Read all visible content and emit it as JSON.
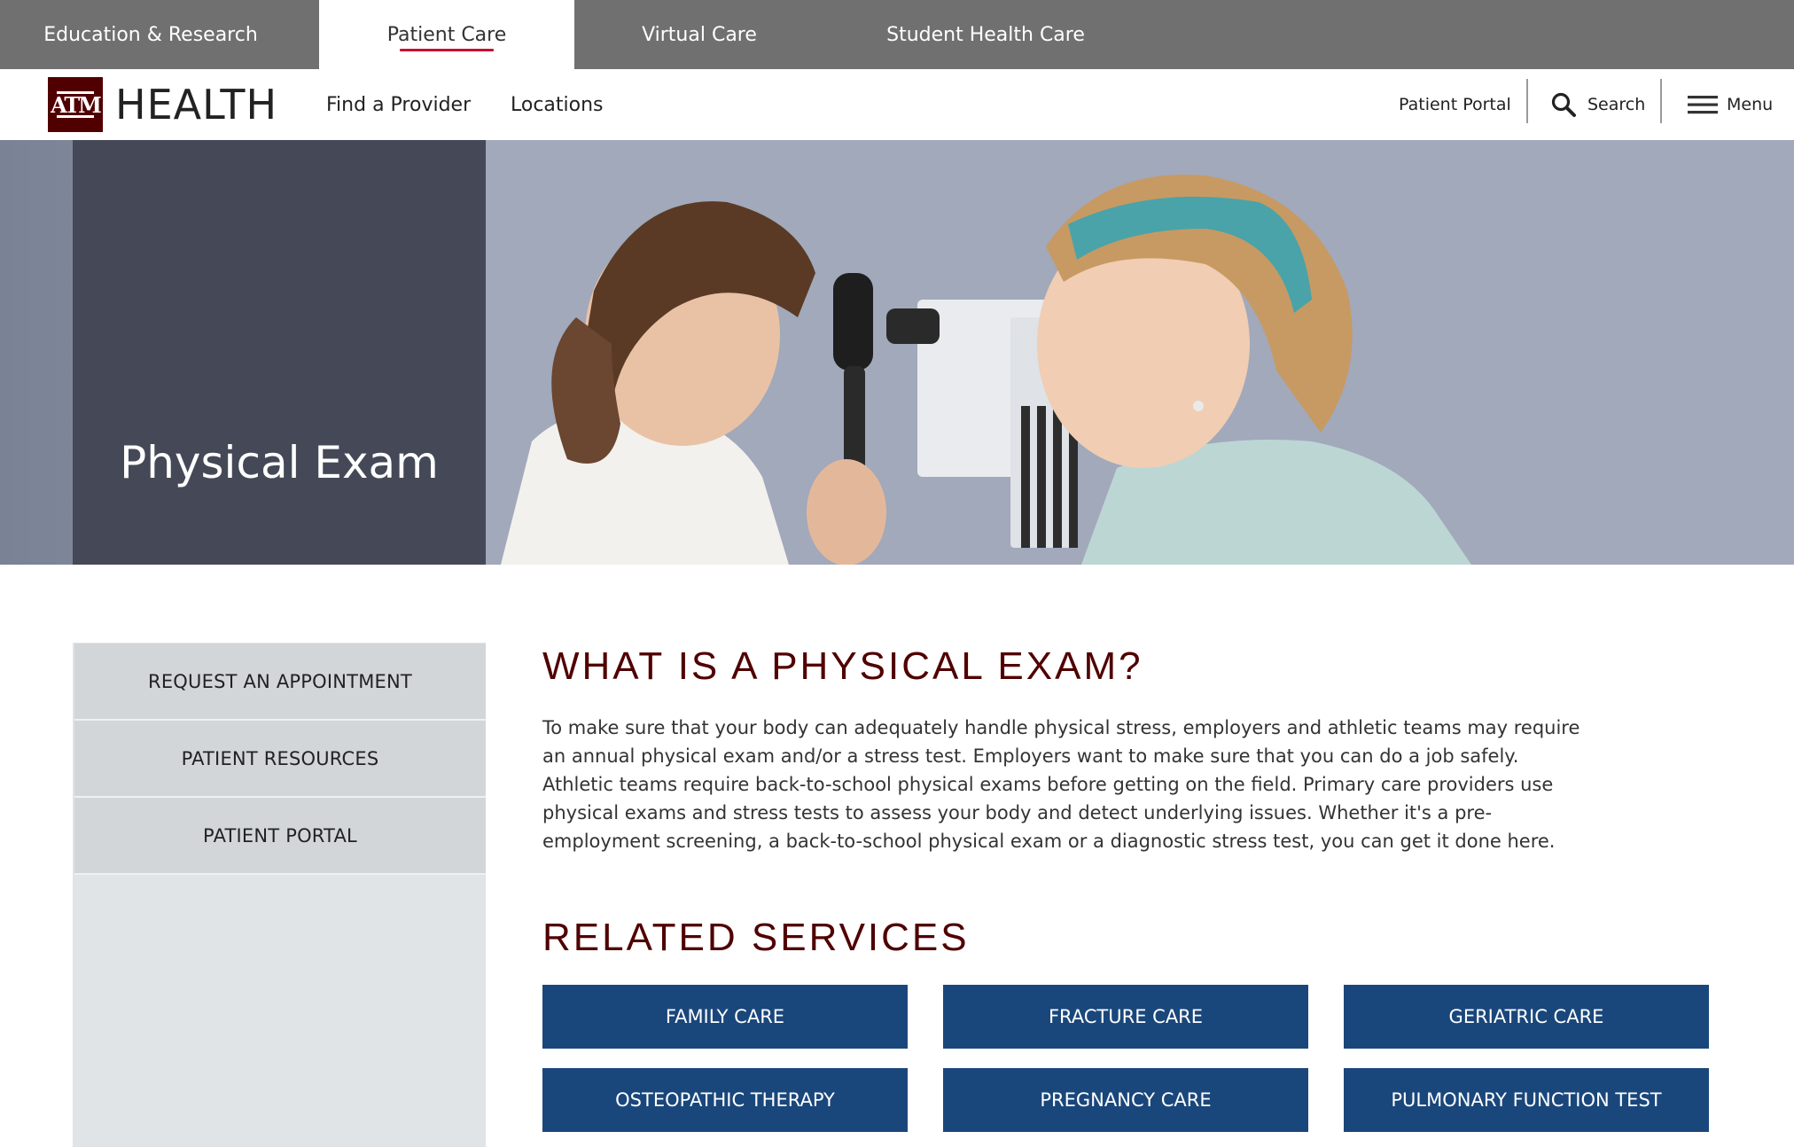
{
  "top_tabs": [
    {
      "label": "Education & Research"
    },
    {
      "label": "Patient Care"
    },
    {
      "label": "Virtual Care"
    },
    {
      "label": "Student Health Care"
    }
  ],
  "header": {
    "logo_mark": "ATM",
    "logo_text": "HEALTH",
    "nav": [
      "Find a Provider",
      "Locations"
    ],
    "patient_portal": "Patient Portal",
    "search": "Search",
    "menu": "Menu"
  },
  "hero": {
    "title": "Physical Exam"
  },
  "sidebar": {
    "items": [
      "REQUEST AN APPOINTMENT",
      "PATIENT RESOURCES",
      "PATIENT PORTAL"
    ]
  },
  "main": {
    "heading": "WHAT IS A PHYSICAL EXAM?",
    "paragraph": "To make sure that your body can adequately handle physical stress, employers and athletic teams may require an annual physical exam and/or a stress test. Employers want to make sure that you can do a job safely. Athletic teams require back-to-school physical exams before getting on the field. Primary care providers use physical exams and stress tests to assess your body and detect underlying issues. Whether it's a pre-employment screening, a back-to-school physical exam or a diagnostic stress test, you can get it done here.",
    "related_heading": "RELATED SERVICES",
    "services": [
      "FAMILY CARE",
      "FRACTURE CARE",
      "GERIATRIC CARE",
      "OSTEOPATHIC THERAPY",
      "PREGNANCY CARE",
      "PULMONARY FUNCTION TEST"
    ]
  },
  "colors": {
    "brand_maroon": "#500000",
    "service_blue": "#1a477b",
    "topbar_gray": "#707070",
    "tab_underline": "#c8102e"
  }
}
